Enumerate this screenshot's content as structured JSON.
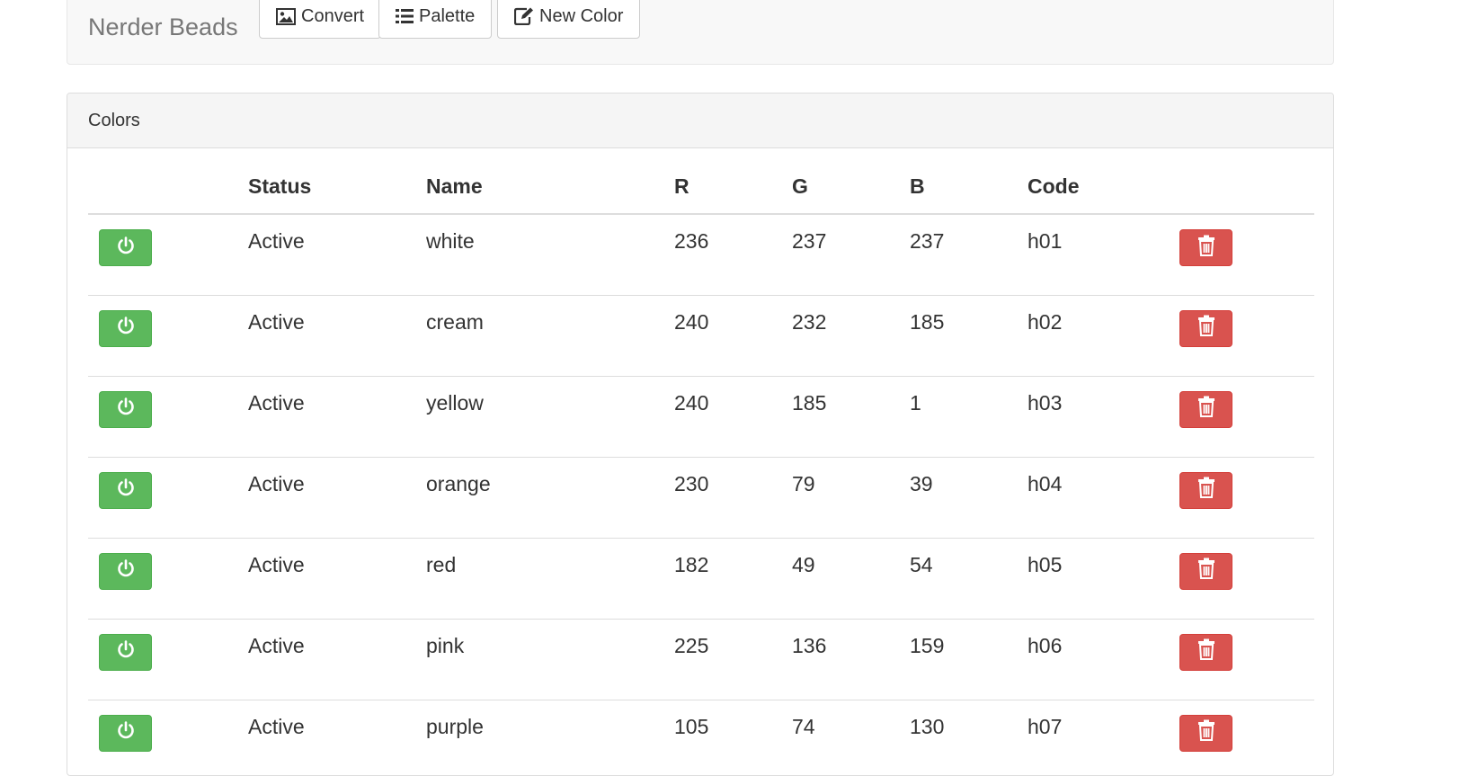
{
  "navbar": {
    "brand": "Nerder Beads",
    "buttons": [
      {
        "label": "Convert",
        "icon": "image-icon"
      },
      {
        "label": "Palette",
        "icon": "list-icon"
      },
      {
        "label": "New Color",
        "icon": "edit-icon"
      }
    ]
  },
  "panel": {
    "title": "Colors",
    "columns": [
      "",
      "Status",
      "Name",
      "R",
      "G",
      "B",
      "Code",
      ""
    ],
    "rows": [
      {
        "status": "Active",
        "name": "white",
        "r": "236",
        "g": "237",
        "b": "237",
        "code": "h01"
      },
      {
        "status": "Active",
        "name": "cream",
        "r": "240",
        "g": "232",
        "b": "185",
        "code": "h02"
      },
      {
        "status": "Active",
        "name": "yellow",
        "r": "240",
        "g": "185",
        "b": "1",
        "code": "h03"
      },
      {
        "status": "Active",
        "name": "orange",
        "r": "230",
        "g": "79",
        "b": "39",
        "code": "h04"
      },
      {
        "status": "Active",
        "name": "red",
        "r": "182",
        "g": "49",
        "b": "54",
        "code": "h05"
      },
      {
        "status": "Active",
        "name": "pink",
        "r": "225",
        "g": "136",
        "b": "159",
        "code": "h06"
      },
      {
        "status": "Active",
        "name": "purple",
        "r": "105",
        "g": "74",
        "b": "130",
        "code": "h07"
      }
    ]
  },
  "colors": {
    "success": "#5cb85c",
    "danger": "#d9534f"
  },
  "icons": {
    "toggle": "power-icon",
    "delete": "trash-icon"
  }
}
